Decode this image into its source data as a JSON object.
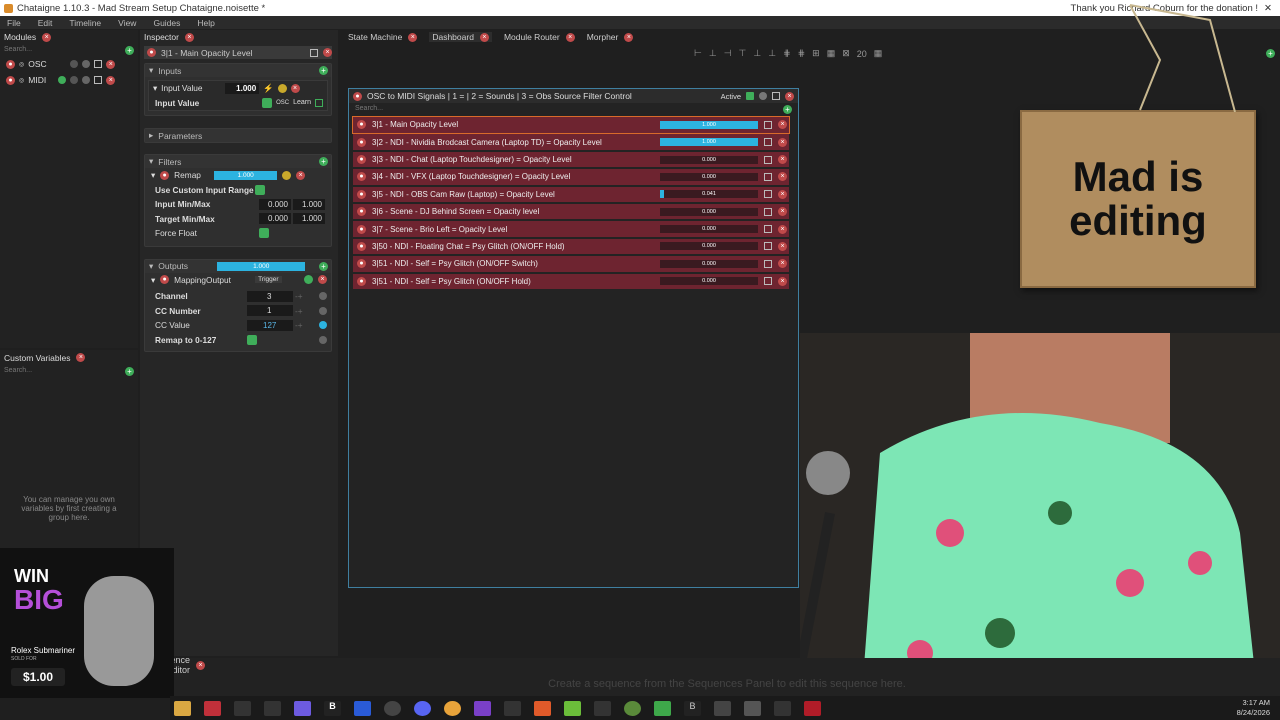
{
  "window": {
    "title": "Chataigne 1.10.3 - Mad Stream Setup Chataigne.noisette *",
    "overlay_text": "Thank you Richard Coburn for the donation !"
  },
  "menu": [
    "File",
    "Edit",
    "Timeline",
    "View",
    "Guides",
    "Help"
  ],
  "modules": {
    "title": "Modules",
    "search": "Search...",
    "items": [
      {
        "label": "OSC"
      },
      {
        "label": "MIDI"
      }
    ]
  },
  "custom_vars": {
    "title": "Custom Variables",
    "search": "Search...",
    "empty": "You can manage you own variables by first creating a group here."
  },
  "inspector": {
    "title": "Inspector",
    "item": "3|1 - Main Opacity Level",
    "inputs": {
      "title": "Inputs",
      "input_value_label": "Input Value",
      "input_value": "1.000",
      "input_value_row": "Input Value",
      "osc": "OSC",
      "learn": "Learn"
    },
    "parameters": "Parameters",
    "filters": {
      "title": "Filters",
      "remap": "Remap",
      "remap_val": "1.000",
      "use_custom": "Use Custom Input Range",
      "in_label": "Input Min/Max",
      "in_min": "0.000",
      "in_max": "1.000",
      "tgt_label": "Target Min/Max",
      "tgt_min": "0.000",
      "tgt_max": "1.000",
      "force": "Force Float"
    },
    "outputs": {
      "title": "Outputs",
      "val": "1.000",
      "mapping": "MappingOutput",
      "trigger": "Trigger",
      "channel_l": "Channel",
      "channel": "3",
      "cc_l": "CC Number",
      "cc": "1",
      "ccv_l": "CC Value",
      "ccv": "127",
      "remap_l": "Remap to 0-127"
    }
  },
  "tabs": [
    "State Machine",
    "Dashboard",
    "Module Router",
    "Morpher"
  ],
  "toolbar": {
    "zoom": "20"
  },
  "node": {
    "title": "OSC to MIDI Signals | 1 =  | 2 = Sounds | 3 = Obs Source Filter Control",
    "active": "Active",
    "search": "Search...",
    "rows": [
      {
        "label": "3|1 - Main Opacity Level",
        "value": 1.0,
        "text": "1.000"
      },
      {
        "label": "3|2 - NDI - Nividia Brodcast Camera (Laptop TD) = Opacity Level",
        "value": 1.0,
        "text": "1.000"
      },
      {
        "label": "3|3 - NDI - Chat (Laptop Touchdesigner) = Opacity Level",
        "value": 0.0,
        "text": "0.000"
      },
      {
        "label": "3|4 - NDI - VFX (Laptop Touchdesigner) = Opacity Level",
        "value": 0.0,
        "text": "0.000"
      },
      {
        "label": "3|5 - NDI - OBS Cam Raw (Laptop) = Opacity Level",
        "value": 0.041,
        "text": "0.041"
      },
      {
        "label": "3|6 - Scene - DJ Behind Screen = Opacity level",
        "value": 0.0,
        "text": "0.000"
      },
      {
        "label": "3|7 - Scene - Brio Left = Opacity Level",
        "value": 0.0,
        "text": "0.000"
      },
      {
        "label": "3|50 - NDI - Floating Chat = Psy Glitch (ON/OFF Hold)",
        "value": 0.0,
        "text": "0.000"
      },
      {
        "label": "3|51 - NDI - Self = Psy Glitch (ON/OFF Switch)",
        "value": 0.0,
        "text": "0.000"
      },
      {
        "label": "3|51 - NDI - Self = Psy Glitch (ON/OFF Hold)",
        "value": 0.0,
        "text": "0.000"
      }
    ]
  },
  "sign": {
    "line1": "Mad is",
    "line2": "editing"
  },
  "ad": {
    "win": "WIN",
    "big": "BIG",
    "product": "Rolex Submariner",
    "sub": "SOLD FOR",
    "price": "$1.00"
  },
  "sequence": {
    "tab": "Sequence Editor",
    "hint": "Create a sequence from the Sequences Panel to edit this sequence here."
  },
  "clock": {
    "time": "3:17 AM",
    "date": "8/24/2026"
  }
}
